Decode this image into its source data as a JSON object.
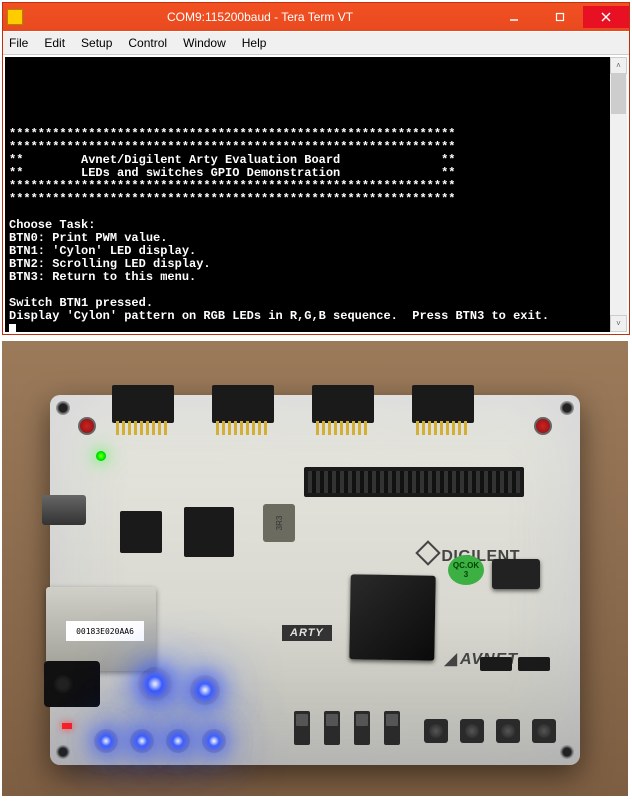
{
  "window": {
    "title": "COM9:115200baud - Tera Term VT"
  },
  "menu": {
    "file": "File",
    "edit": "Edit",
    "setup": "Setup",
    "control": "Control",
    "window": "Window",
    "help": "Help"
  },
  "terminal": {
    "lines": [
      "",
      "",
      "",
      "",
      "",
      "**************************************************************",
      "**************************************************************",
      "**        Avnet/Digilent Arty Evaluation Board              **",
      "**        LEDs and switches GPIO Demonstration              **",
      "**************************************************************",
      "**************************************************************",
      "",
      "Choose Task:",
      "BTN0: Print PWM value.",
      "BTN1: 'Cylon' LED display.",
      "BTN2: Scrolling LED display.",
      "BTN3: Return to this menu.",
      "",
      "Switch BTN1 pressed.",
      "Display 'Cylon' pattern on RGB LEDs in R,G,B sequence.  Press BTN3 to exit."
    ]
  },
  "board": {
    "mac": "00183E020AA6",
    "inductor": "3R3",
    "qcok_top": "QC.OK",
    "qcok_num": "3",
    "logo_digilent": "DIGILENT",
    "logo_avnet": "AVNET",
    "logo_arty": "ARTY"
  }
}
